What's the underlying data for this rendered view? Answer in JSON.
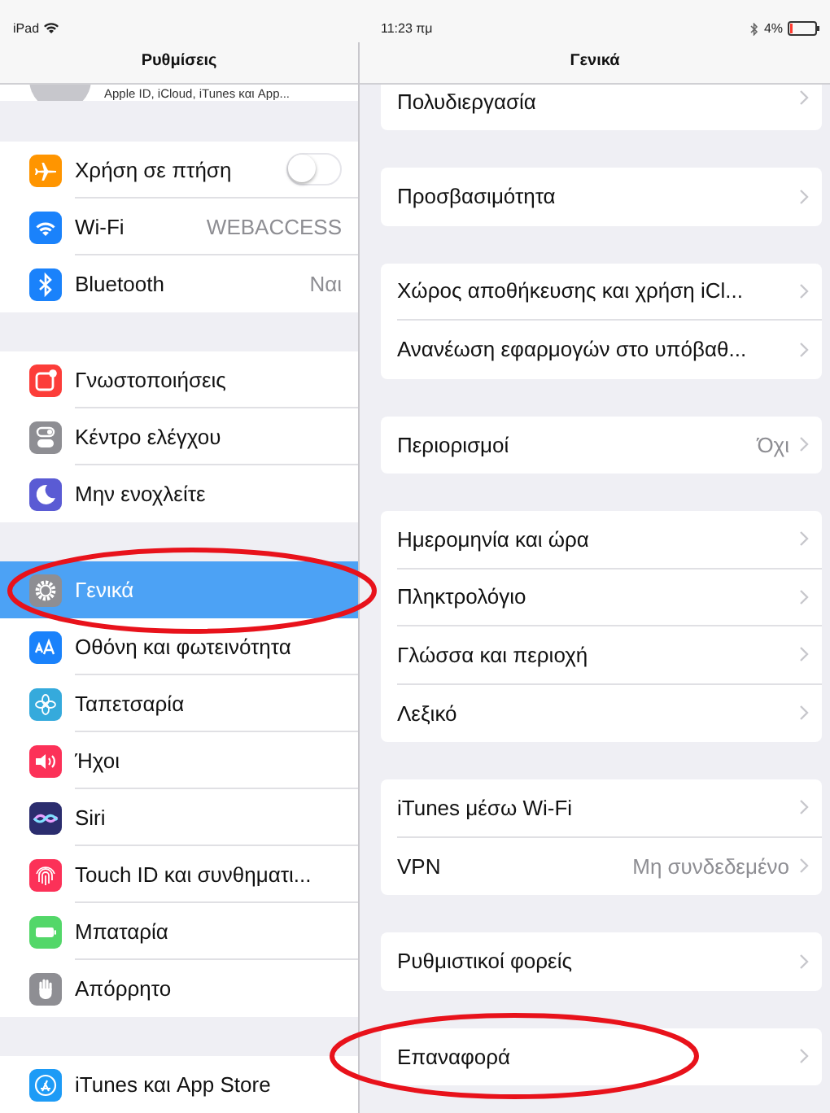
{
  "status_bar": {
    "device": "iPad",
    "time": "11:23 πμ",
    "battery": "4%"
  },
  "sidebar": {
    "title": "Ρυθμίσεις",
    "profile_subtitle": "Apple ID, iCloud, iTunes και App...",
    "groups": [
      {
        "items": [
          {
            "label": "Χρήση σε πτήση",
            "kind": "toggle",
            "on": false,
            "color": "#ff9500",
            "selected": false,
            "circled": false
          },
          {
            "label": "Wi-Fi",
            "kind": "value",
            "value": "WEBACCESS",
            "color": "#1a82fb",
            "selected": false,
            "circled": false
          },
          {
            "label": "Bluetooth",
            "kind": "value",
            "value": "Ναι",
            "color": "#1a82fb",
            "selected": false,
            "circled": false
          }
        ]
      },
      {
        "items": [
          {
            "label": "Γνωστοποιήσεις",
            "kind": "plain",
            "color": "#fc3d39",
            "selected": false,
            "circled": false
          },
          {
            "label": "Κέντρο ελέγχου",
            "kind": "plain",
            "color": "#8e8e93",
            "selected": false,
            "circled": false
          },
          {
            "label": "Μην ενοχλείτε",
            "kind": "plain",
            "color": "#5a5bd4",
            "selected": false,
            "circled": false
          }
        ]
      },
      {
        "items": [
          {
            "label": "Γενικά",
            "kind": "plain",
            "color": "#8e8e93",
            "selected": true,
            "circled": true
          },
          {
            "label": "Οθόνη και φωτεινότητα",
            "kind": "plain",
            "color": "#1a82fb",
            "selected": false,
            "circled": false
          },
          {
            "label": "Ταπετσαρία",
            "kind": "plain",
            "color": "#35aadc",
            "selected": false,
            "circled": false
          },
          {
            "label": "Ήχοι",
            "kind": "plain",
            "color": "#fc3158",
            "selected": false,
            "circled": false
          },
          {
            "label": "Siri",
            "kind": "plain",
            "color": "#2b2d6e",
            "selected": false,
            "circled": false
          },
          {
            "label": "Touch ID και συνθηματι...",
            "kind": "plain",
            "color": "#fc3158",
            "selected": false,
            "circled": false
          },
          {
            "label": "Μπαταρία",
            "kind": "plain",
            "color": "#53d769",
            "selected": false,
            "circled": false
          },
          {
            "label": "Απόρρητο",
            "kind": "plain",
            "color": "#8e8e93",
            "selected": false,
            "circled": false
          }
        ]
      },
      {
        "items": [
          {
            "label": "iTunes και App Store",
            "kind": "plain",
            "color": "#1d9bf6",
            "selected": false,
            "circled": false
          }
        ]
      }
    ]
  },
  "detail": {
    "title": "Γενικά",
    "groups": [
      {
        "cut_off": true,
        "items": [
          {
            "label": "Πολυδιεργασία",
            "circled": false
          }
        ]
      },
      {
        "cut_off": false,
        "items": [
          {
            "label": "Προσβασιμότητα",
            "circled": false
          }
        ]
      },
      {
        "cut_off": false,
        "items": [
          {
            "label": "Χώρος αποθήκευσης και χρήση iCl...",
            "circled": false
          },
          {
            "label": "Ανανέωση εφαρμογών στο υπόβαθ...",
            "circled": false
          }
        ]
      },
      {
        "cut_off": false,
        "items": [
          {
            "label": "Περιορισμοί",
            "value": "Όχι",
            "circled": false
          }
        ]
      },
      {
        "cut_off": false,
        "items": [
          {
            "label": "Ημερομηνία και ώρα",
            "circled": false
          },
          {
            "label": "Πληκτρολόγιο",
            "circled": false
          },
          {
            "label": "Γλώσσα και περιοχή",
            "circled": false
          },
          {
            "label": "Λεξικό",
            "circled": false
          }
        ]
      },
      {
        "cut_off": false,
        "items": [
          {
            "label": "iTunes μέσω Wi-Fi",
            "circled": false
          },
          {
            "label": "VPN",
            "value": "Μη συνδεδεμένο",
            "circled": false
          }
        ]
      },
      {
        "cut_off": false,
        "items": [
          {
            "label": "Ρυθμιστικοί φορείς",
            "circled": false
          }
        ]
      },
      {
        "cut_off": false,
        "items": [
          {
            "label": "Επαναφορά",
            "circled": true
          }
        ]
      }
    ]
  }
}
